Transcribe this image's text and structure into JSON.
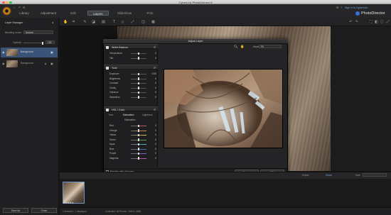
{
  "window": {
    "title": "CyberLink PhotoDirector 8"
  },
  "header": {
    "modes": [
      "Library",
      "Adjustment"
    ],
    "subtabs": [
      "Edit",
      "Layers",
      "Slideshow",
      "Print"
    ],
    "active_subtab": "Layers",
    "sign_in": "Sign in to CyberLink",
    "brand": "PhotoDirector"
  },
  "layer_manager": {
    "title": "Layer Manager",
    "blending_label": "Blending mode:",
    "blending_value": "Normal",
    "opacity_label": "Opacity:",
    "opacity_value": "100",
    "layers": [
      {
        "name": "Background",
        "selected": true
      },
      {
        "name": "Background",
        "selected": false
      }
    ],
    "buttons": [
      "Save As",
      "Close"
    ]
  },
  "dialog": {
    "title": "Adjust Layer",
    "zoom_label": "Zoom:",
    "zoom_value": "Fit",
    "sections": {
      "white_balance": {
        "title": "White Balance",
        "sliders": [
          {
            "name": "Temperature",
            "value": "0",
            "level": 0.5
          },
          {
            "name": "Tint",
            "value": "0",
            "level": 0.5
          }
        ]
      },
      "tone": {
        "title": "Tone",
        "sliders": [
          {
            "name": "Exposure",
            "value": "0.00",
            "level": 0.5
          },
          {
            "name": "Brightness",
            "value": "0",
            "level": 0.5
          },
          {
            "name": "Contrast",
            "value": "0",
            "level": 0.5
          },
          {
            "name": "Clarity",
            "value": "0",
            "level": 0.5
          },
          {
            "name": "Vibrance",
            "value": "0",
            "level": 0.5
          },
          {
            "name": "Saturation",
            "value": "0",
            "level": 0.5
          }
        ]
      },
      "hsl": {
        "title": "HSL / Color",
        "tabs": [
          "Hue",
          "Saturation",
          "Lightness"
        ],
        "active_tab": "Saturation",
        "group_label": "Saturation",
        "sliders": [
          {
            "name": "Red",
            "value": "0",
            "level": 0.5,
            "color": "#d9534f"
          },
          {
            "name": "Orange",
            "value": "0",
            "level": 0.5,
            "color": "#e8913a"
          },
          {
            "name": "Yellow",
            "value": "0",
            "level": 0.5,
            "color": "#e6d33a"
          },
          {
            "name": "Green",
            "value": "0",
            "level": 0.5,
            "color": "#4cae4c"
          },
          {
            "name": "Aqua",
            "value": "0",
            "level": 0.5,
            "color": "#3fbfbf"
          },
          {
            "name": "Blue",
            "value": "0",
            "level": 0.5,
            "color": "#3b6fd9"
          },
          {
            "name": "Purple",
            "value": "0",
            "level": 0.5,
            "color": "#8e5bd6"
          },
          {
            "name": "Magenta",
            "value": "0",
            "level": 0.5,
            "color": "#d64fbf"
          }
        ]
      }
    },
    "preview_all_layers_label": "Preview with all layers",
    "buttons": {
      "cancel": "Cancel",
      "ok": "OK"
    }
  },
  "filmstrip": {
    "export_label": "Export",
    "share_label": "Share",
    "sort_label": "Sort:",
    "rating": "★★★★★"
  },
  "status": {
    "left": "1 selected - 1 displayed",
    "right": "Collection: All Photos - 5184 x 3456"
  },
  "icons": {
    "window": [
      "close-icon",
      "minimize-icon",
      "zoom-icon"
    ],
    "toolbar": [
      "hand-icon",
      "crop-icon",
      "brush-icon",
      "eraser-icon",
      "gradient-icon",
      "text-icon",
      "shape-icon",
      "transform-icon",
      "layer-icon",
      "fill-icon",
      "undo-icon",
      "redo-icon"
    ]
  },
  "colors": {
    "accent": "#3a5378",
    "link": "#6fa8dc",
    "logo": "#d98a1e"
  }
}
